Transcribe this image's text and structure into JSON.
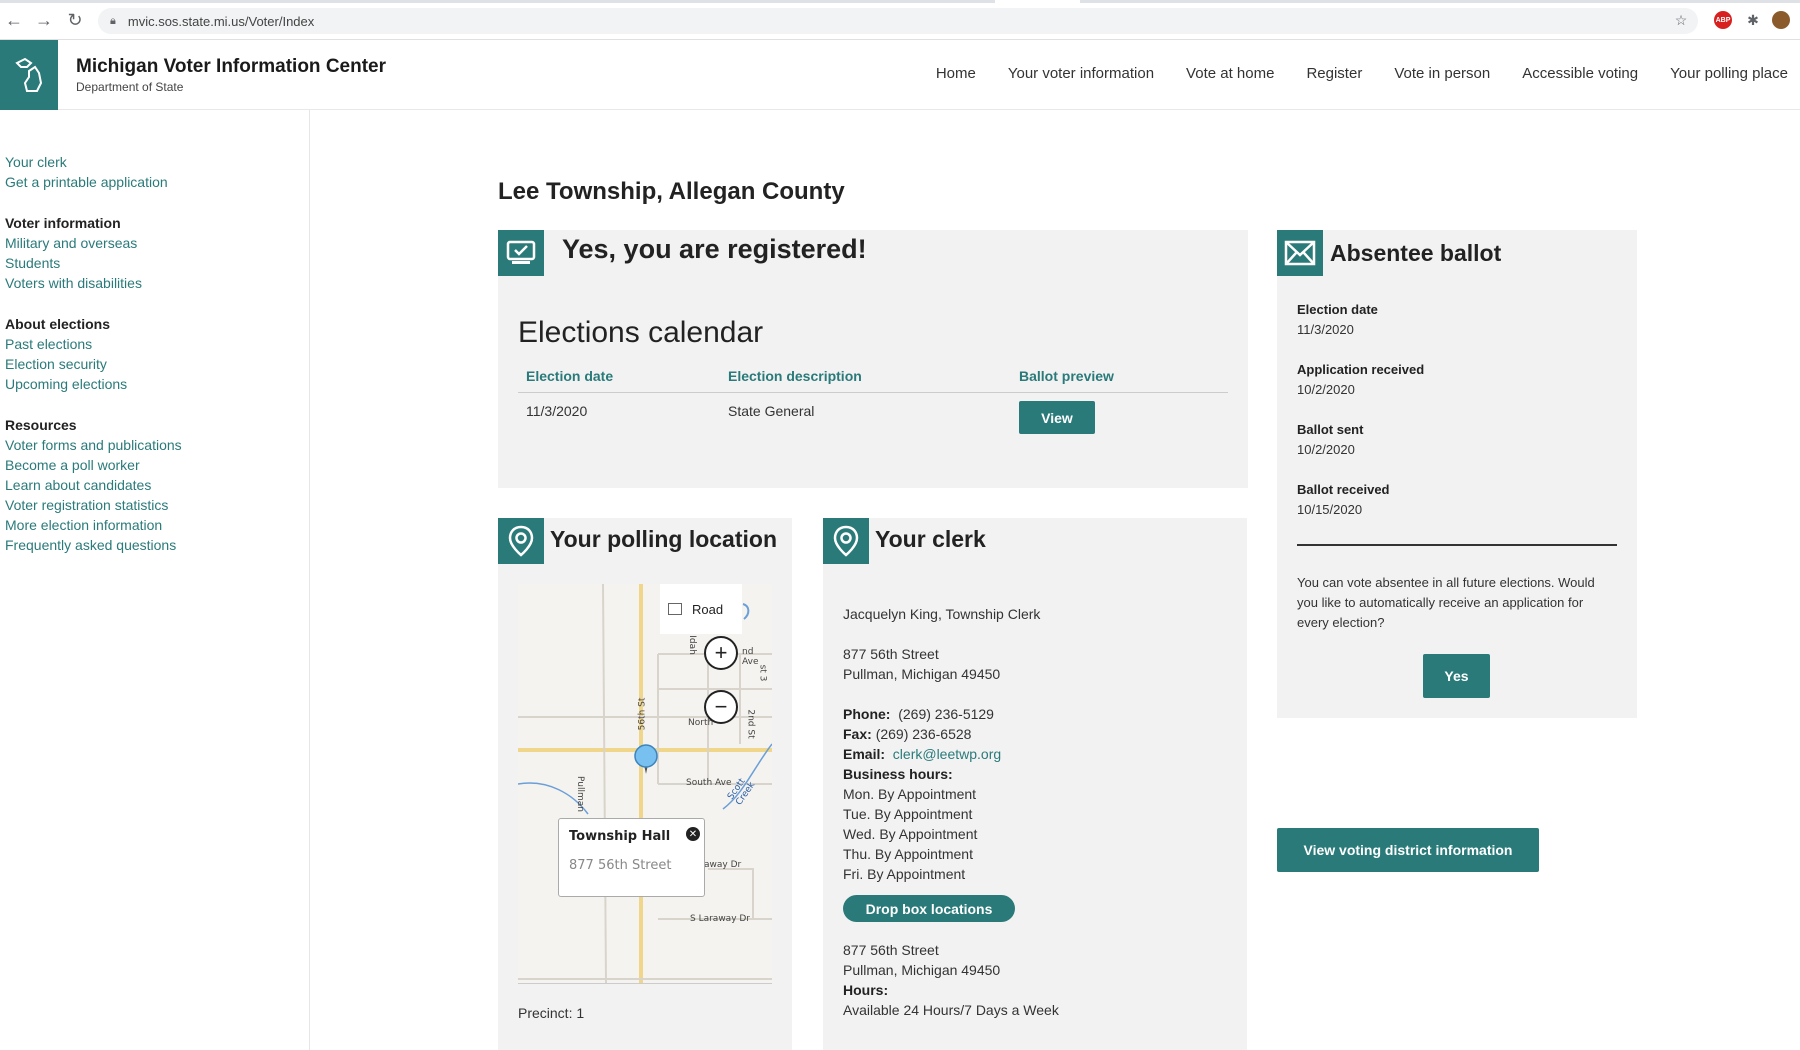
{
  "browser": {
    "url": "mvic.sos.state.mi.us/Voter/Index",
    "icons": [
      "back-icon",
      "forward-icon",
      "reload-icon",
      "lock-icon",
      "star-icon",
      "adblock-icon",
      "extensions-icon",
      "profile-icon"
    ],
    "adblock_label": "ABP"
  },
  "header": {
    "title": "Michigan Voter Information Center",
    "subtitle": "Department of State",
    "nav": [
      "Home",
      "Your voter information",
      "Vote at home",
      "Register",
      "Vote in person",
      "Accessible voting",
      "Your polling place"
    ]
  },
  "sidebar": {
    "top_links": [
      "Your clerk",
      "Get a printable application"
    ],
    "groups": [
      {
        "title": "Voter information",
        "links": [
          "Military and overseas",
          "Students",
          "Voters with disabilities"
        ]
      },
      {
        "title": "About elections",
        "links": [
          "Past elections",
          "Election security",
          "Upcoming elections"
        ]
      },
      {
        "title": "Resources",
        "links": [
          "Voter forms and publications",
          "Become a poll worker",
          "Learn about candidates",
          "Voter registration statistics",
          "More election information",
          "Frequently asked questions"
        ]
      }
    ]
  },
  "main": {
    "county_title": "Lee Township, Allegan County",
    "registered_heading": "Yes, you are registered!",
    "calendar": {
      "title": "Elections calendar",
      "headers": [
        "Election date",
        "Election description",
        "Ballot preview"
      ],
      "rows": [
        {
          "date": "11/3/2020",
          "description": "State General",
          "action": "View"
        }
      ]
    },
    "polling": {
      "heading": "Your polling location",
      "map_type": "Road",
      "popup_title": "Township Hall",
      "popup_address": "877 56th Street",
      "street_labels": [
        "South Ave",
        "North",
        "S Laraway Dr",
        "away Dr",
        "Pullman",
        "56th St",
        "Scott Creek",
        "nd Ave",
        "Idah",
        "2nd St",
        "st 3"
      ],
      "precinct": "Precinct: 1"
    },
    "clerk": {
      "heading": "Your clerk",
      "name": "Jacquelyn King, Township Clerk",
      "address1": "877 56th Street",
      "address2": "Pullman, Michigan 49450",
      "phone_label": "Phone:",
      "phone": "(269) 236-5129",
      "fax_label": "Fax:",
      "fax": "(269) 236-6528",
      "email_label": "Email:",
      "email": "clerk@leetwp.org",
      "hours_label": "Business hours:",
      "hours": [
        "Mon. By Appointment",
        "Tue. By Appointment",
        "Wed. By Appointment",
        "Thu. By Appointment",
        "Fri. By Appointment"
      ],
      "dropbox_button": "Drop box locations",
      "dropbox_address1": "877 56th Street",
      "dropbox_address2": "Pullman, Michigan 49450",
      "dropbox_hours_label": "Hours:",
      "dropbox_hours": "Available 24 Hours/7 Days a Week"
    },
    "absentee": {
      "heading": "Absentee ballot",
      "items": [
        {
          "label": "Election date",
          "value": "11/3/2020"
        },
        {
          "label": "Application received",
          "value": "10/2/2020"
        },
        {
          "label": "Ballot sent",
          "value": "10/2/2020"
        },
        {
          "label": "Ballot received",
          "value": "10/15/2020"
        }
      ],
      "note": "You can vote absentee in all future elections. Would you like to automatically receive an application for every election?",
      "yes_button": "Yes"
    },
    "district_button": "View voting district information"
  },
  "colors": {
    "accent": "#2a7a7a",
    "panel": "#f2f2f2"
  }
}
